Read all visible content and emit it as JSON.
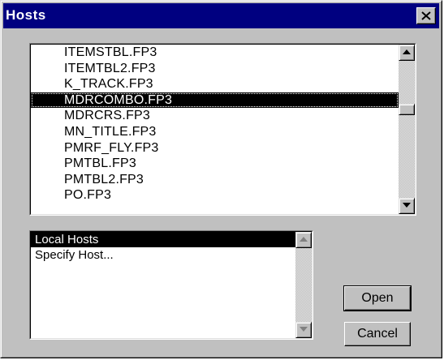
{
  "window": {
    "title": "Hosts"
  },
  "files": {
    "items": [
      "ITEMSTBL.FP3",
      "ITEMTBL2.FP3",
      "K_TRACK.FP3",
      "MDRCOMBO.FP3",
      "MDRCRS.FP3",
      "MN_TITLE.FP3",
      "PMRF_FLY.FP3",
      "PMTBL.FP3",
      "PMTBL2.FP3",
      "PO.FP3"
    ],
    "selected": "MDRCOMBO.FP3"
  },
  "hosts": {
    "items": [
      "Local Hosts",
      "Specify Host..."
    ],
    "selected": "Local Hosts"
  },
  "buttons": {
    "open_label": "Open",
    "cancel_label": "Cancel"
  },
  "icons": {
    "close": "close-icon",
    "scroll_up": "arrow-up-icon",
    "scroll_down": "arrow-down-icon"
  },
  "colors": {
    "titlebar": "#000080",
    "face": "#c0c0c0",
    "selection": "#000000"
  }
}
